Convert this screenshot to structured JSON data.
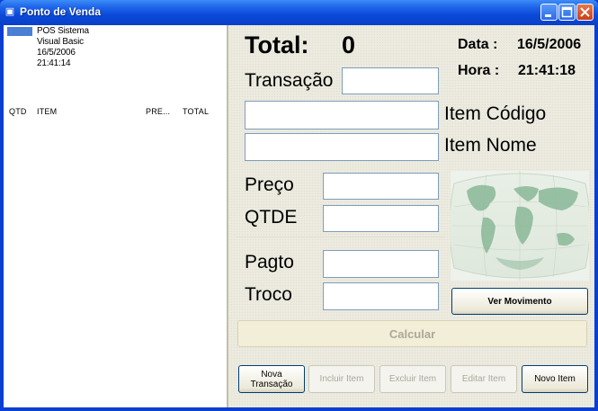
{
  "window": {
    "title": "Ponto de Venda",
    "icon": "app-icon"
  },
  "list": {
    "info_lines": [
      "POS Sistema",
      "Visual Basic",
      "16/5/2006",
      "21:41:14"
    ],
    "columns": [
      "QTD",
      "ITEM",
      "PRE...",
      "TOTAL"
    ]
  },
  "total": {
    "label": "Total:",
    "value": "0"
  },
  "datetime": {
    "date_label": "Data :",
    "date_value": "16/5/2006",
    "time_label": "Hora :",
    "time_value": "21:41:18"
  },
  "fields": {
    "transacao": {
      "label": "Transação",
      "value": ""
    },
    "item_codigo": {
      "label": "Item Código",
      "value": ""
    },
    "item_nome": {
      "label": "Item Nome",
      "value": ""
    },
    "preco": {
      "label": "Preço",
      "value": ""
    },
    "qtde": {
      "label": "QTDE",
      "value": ""
    },
    "pagto": {
      "label": "Pagto",
      "value": ""
    },
    "troco": {
      "label": "Troco",
      "value": ""
    }
  },
  "buttons": {
    "ver_movimento": "Ver Movimento",
    "calcular": "Calcular",
    "nova_transacao_1": "Nova",
    "nova_transacao_2": "Transação",
    "incluir_item": "Incluir Item",
    "excluir_item": "Excluir Item",
    "editar_item": "Editar Item",
    "novo_item": "Novo Item"
  },
  "colors": {
    "title_bar": "#0a4ad8",
    "accent_map": "#7aa88a",
    "disabled_text": "#aca899"
  }
}
